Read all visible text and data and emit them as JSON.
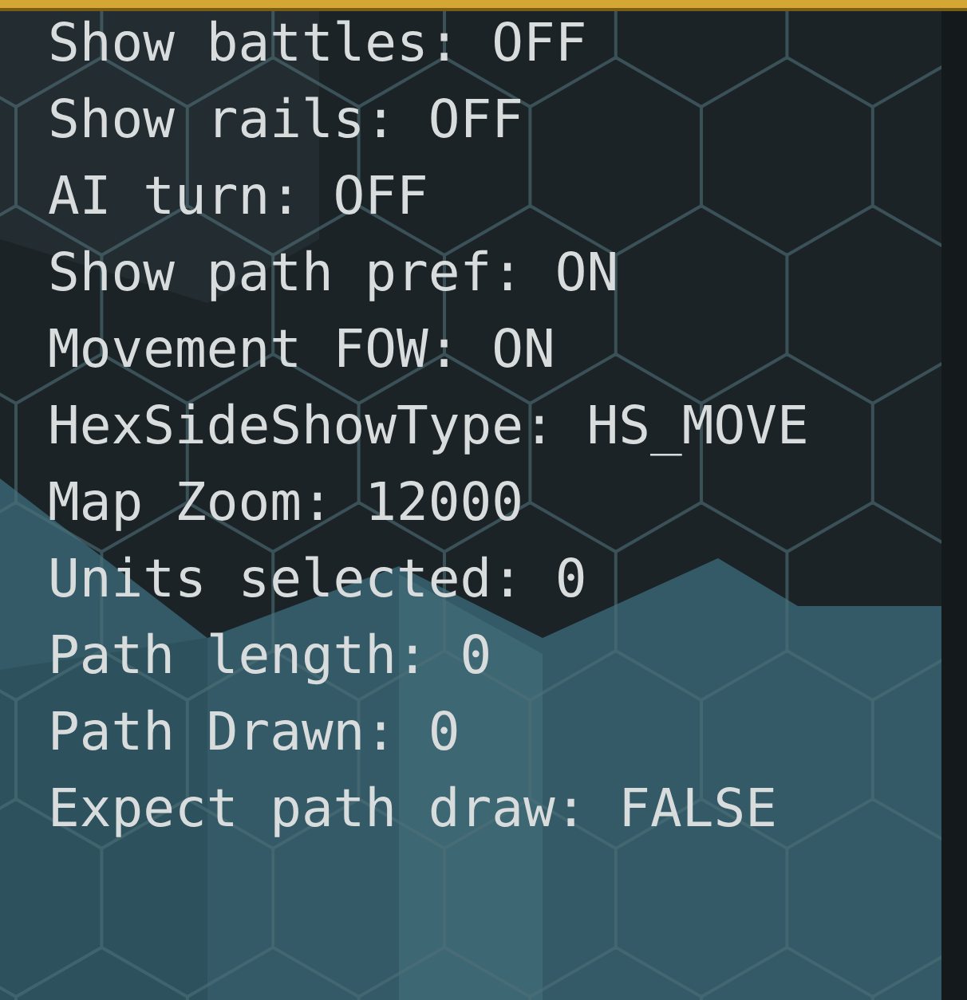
{
  "lines": [
    "Show battles: OFF",
    "Show rails: OFF",
    "AI turn: OFF",
    "Show path pref: ON",
    "Movement FOW: ON",
    "HexSideShowType: HS_MOVE",
    "Map Zoom: 12000",
    "Units selected: 0",
    "Path length: 0",
    "Path Drawn: 0",
    "Expect path draw: FALSE"
  ]
}
